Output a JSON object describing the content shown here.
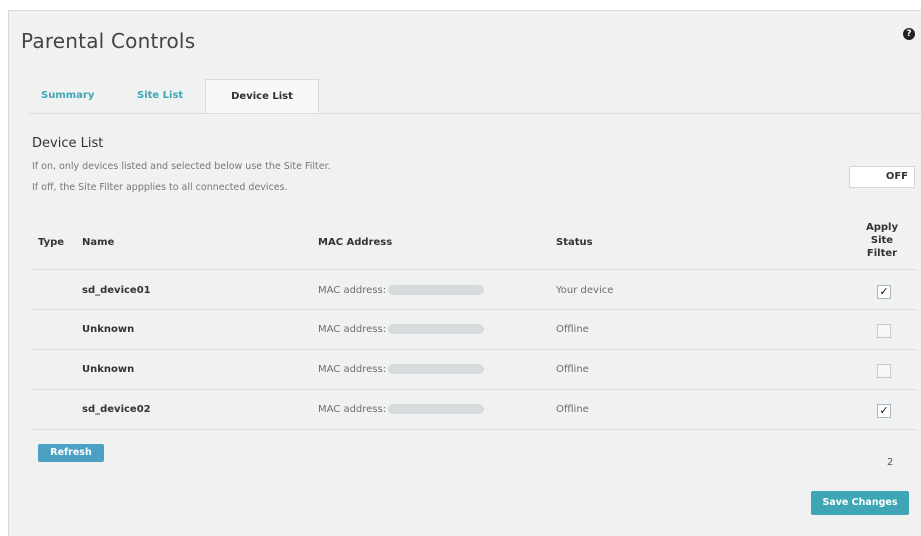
{
  "page": {
    "title": "Parental Controls"
  },
  "tabs": [
    {
      "label": "Summary",
      "active": false
    },
    {
      "label": "Site List",
      "active": false
    },
    {
      "label": "Device List",
      "active": true
    }
  ],
  "device_list": {
    "title": "Device List",
    "desc_on": "If on, only devices listed and selected below use the Site Filter.",
    "desc_off": "If off, the Site Filter appplies to all connected devices.",
    "toggle_label": "OFF"
  },
  "table": {
    "columns": {
      "type": "Type",
      "name": "Name",
      "mac": "MAC Address",
      "status": "Status",
      "apply": [
        "Apply",
        "Site",
        "Filter"
      ]
    },
    "rows": [
      {
        "name": "sd_device01",
        "mac_label": "MAC address:",
        "status": "Your device",
        "checked": true
      },
      {
        "name": "Unknown",
        "mac_label": "MAC address:",
        "status": "Offline",
        "checked": false
      },
      {
        "name": "Unknown",
        "mac_label": "MAC address:",
        "status": "Offline",
        "checked": false
      },
      {
        "name": "sd_device02",
        "mac_label": "MAC address:",
        "status": "Offline",
        "checked": true
      }
    ]
  },
  "buttons": {
    "refresh": "Refresh",
    "save": "Save Changes"
  },
  "selected_count": "2",
  "colors": {
    "accent": "#3fa6b5",
    "refresh": "#4ba0c4",
    "panel": "#f0f1f1"
  },
  "icons": {
    "help": "help-icon",
    "check": "checkmark-icon"
  }
}
